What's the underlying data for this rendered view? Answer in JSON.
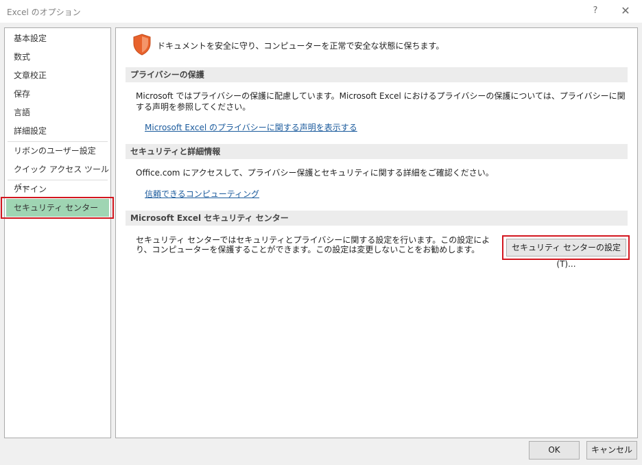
{
  "window": {
    "title": "Excel のオプション",
    "help_glyph": "?",
    "close_glyph": "✕"
  },
  "nav": {
    "items": [
      {
        "label": "基本設定"
      },
      {
        "label": "数式"
      },
      {
        "label": "文章校正"
      },
      {
        "label": "保存"
      },
      {
        "label": "言語"
      },
      {
        "label": "詳細設定"
      },
      {
        "label": "リボンのユーザー設定"
      },
      {
        "label": "クイック アクセス ツール バー"
      },
      {
        "label": "アドイン"
      },
      {
        "label": "セキュリティ センター"
      }
    ],
    "selected": "セキュリティ センター"
  },
  "main": {
    "header": "ドキュメントを安全に守り、コンピューターを正常で安全な状態に保ちます。",
    "privacy": {
      "heading": "プライバシーの保護",
      "text": "Microsoft ではプライバシーの保護に配慮しています。Microsoft Excel におけるプライバシーの保護については、プライバシーに関する声明を参照してください。",
      "link": "Microsoft Excel のプライバシーに関する声明を表示する"
    },
    "security": {
      "heading": "セキュリティと詳細情報",
      "text": "Office.com にアクセスして、プライバシー保護とセキュリティに関する詳細をご確認ください。",
      "link": "信頼できるコンピューティング"
    },
    "trust_center": {
      "heading": "Microsoft Excel セキュリティ センター",
      "text": "セキュリティ センターではセキュリティとプライバシーに関する設定を行います。この設定により、コンピューターを保護することができます。この設定は変更しないことをお勧めします。",
      "button": "セキュリティ センターの設定(T)..."
    }
  },
  "footer": {
    "ok": "OK",
    "cancel": "キャンセル"
  },
  "colors": {
    "selected_nav": "#9fd5b3",
    "highlight_border": "#d2161e",
    "shield": "#e8622c",
    "link": "#1a5a9c"
  }
}
